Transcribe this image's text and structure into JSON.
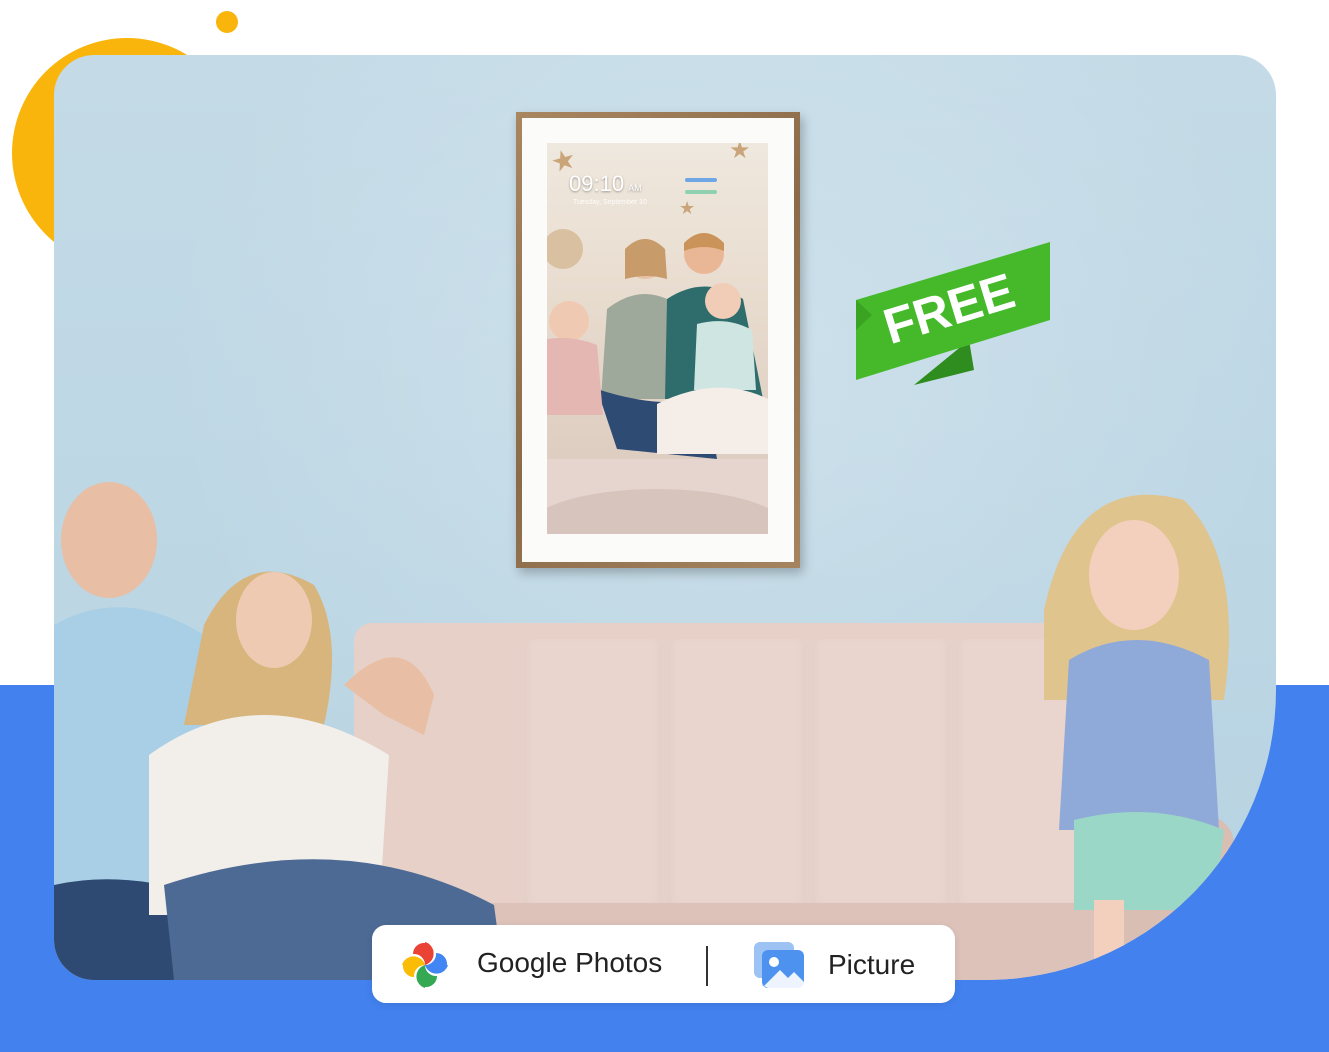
{
  "frame_screen": {
    "clock_time": "09:10",
    "clock_ampm": "AM",
    "clock_date": "Tuesday, September 10"
  },
  "badge": {
    "text": "FREE",
    "color": "#3fb52b"
  },
  "source_bar": {
    "google_photos_label": "Google Photos",
    "picture_label": "Picture",
    "google_photos_icon": "google-photos-icon",
    "picture_icon": "image-icon"
  },
  "colors": {
    "accent_blue": "#4281ee",
    "accent_yellow": "#f9b50b",
    "wall": "#c4dbe7"
  }
}
